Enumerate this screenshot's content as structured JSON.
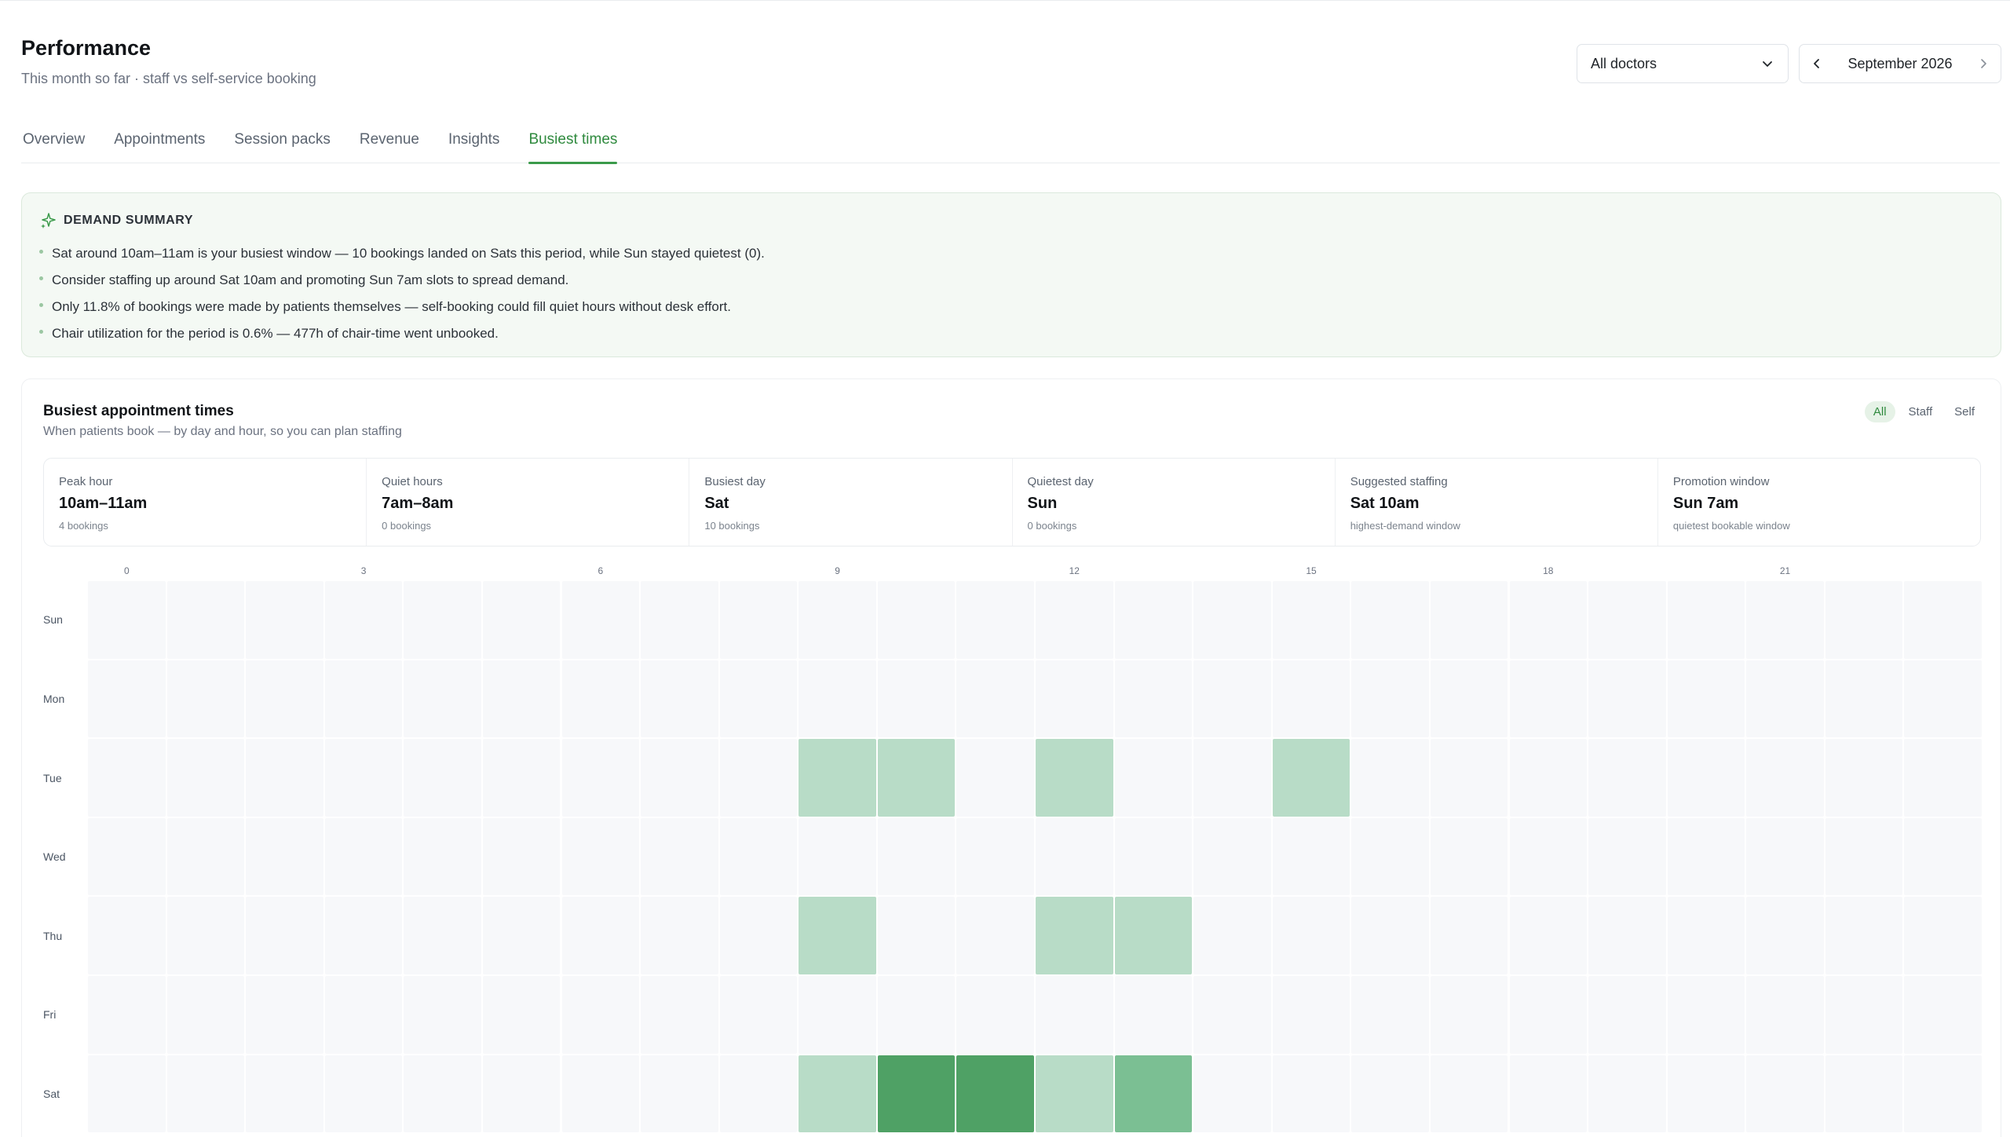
{
  "header": {
    "title": "Performance",
    "subtitle": "This month so far · staff vs self-service booking"
  },
  "controls": {
    "doctor_select": "All doctors",
    "month": "September 2026",
    "icons": [
      "chevron-down-icon",
      "chevron-left-icon",
      "chevron-right-icon"
    ]
  },
  "tabs": [
    {
      "label": "Overview",
      "active": false
    },
    {
      "label": "Appointments",
      "active": false
    },
    {
      "label": "Session packs",
      "active": false
    },
    {
      "label": "Revenue",
      "active": false
    },
    {
      "label": "Insights",
      "active": false
    },
    {
      "label": "Busiest times",
      "active": true
    }
  ],
  "summary": {
    "title": "DEMAND SUMMARY",
    "icon": "sparkle-icon",
    "bullets": [
      "Sat around 10am–11am is your busiest window — 10 bookings landed on Sats this period, while Sun stayed quietest (0).",
      "Consider staffing up around Sat 10am and promoting Sun 7am slots to spread demand.",
      "Only 11.8% of bookings were made by patients themselves — self-booking could fill quiet hours without desk effort.",
      "Chair utilization for the period is 0.6% — 477h of chair-time went unbooked."
    ]
  },
  "panel": {
    "title": "Busiest appointment times",
    "subtitle": "When patients book — by day and hour, so you can plan staffing",
    "filters": [
      {
        "label": "All",
        "active": true
      },
      {
        "label": "Staff",
        "active": false
      },
      {
        "label": "Self",
        "active": false
      }
    ],
    "stats": [
      {
        "label": "Peak hour",
        "value": "10am–11am",
        "note": "4 bookings"
      },
      {
        "label": "Quiet hours",
        "value": "7am–8am",
        "note": "0 bookings"
      },
      {
        "label": "Busiest day",
        "value": "Sat",
        "note": "10 bookings"
      },
      {
        "label": "Quietest day",
        "value": "Sun",
        "note": "0 bookings"
      },
      {
        "label": "Suggested staffing",
        "value": "Sat 10am",
        "note": "highest-demand window"
      },
      {
        "label": "Promotion window",
        "value": "Sun 7am",
        "note": "quietest bookable window"
      }
    ]
  },
  "colors": {
    "accent": "#2f8a3e",
    "empty_cell": "#f7f8fa",
    "level_1": "#b8dcc7",
    "level_2": "#7bbf93",
    "level_3": "#4fa165"
  },
  "chart_data": {
    "type": "heatmap",
    "x_tick_labels": [
      "0",
      "3",
      "6",
      "9",
      "12",
      "15",
      "18",
      "21"
    ],
    "x": [
      0,
      1,
      2,
      3,
      4,
      5,
      6,
      7,
      8,
      9,
      10,
      11,
      12,
      13,
      14,
      15,
      16,
      17,
      18,
      19,
      20,
      21,
      22,
      23
    ],
    "y": [
      "Sun",
      "Mon",
      "Tue",
      "Wed",
      "Thu",
      "Fri",
      "Sat"
    ],
    "values": [
      [
        0,
        0,
        0,
        0,
        0,
        0,
        0,
        0,
        0,
        0,
        0,
        0,
        0,
        0,
        0,
        0,
        0,
        0,
        0,
        0,
        0,
        0,
        0,
        0
      ],
      [
        0,
        0,
        0,
        0,
        0,
        0,
        0,
        0,
        0,
        0,
        0,
        0,
        0,
        0,
        0,
        0,
        0,
        0,
        0,
        0,
        0,
        0,
        0,
        0
      ],
      [
        0,
        0,
        0,
        0,
        0,
        0,
        0,
        0,
        0,
        1,
        1,
        0,
        1,
        0,
        0,
        1,
        0,
        0,
        0,
        0,
        0,
        0,
        0,
        0
      ],
      [
        0,
        0,
        0,
        0,
        0,
        0,
        0,
        0,
        0,
        0,
        0,
        0,
        0,
        0,
        0,
        0,
        0,
        0,
        0,
        0,
        0,
        0,
        0,
        0
      ],
      [
        0,
        0,
        0,
        0,
        0,
        0,
        0,
        0,
        0,
        1,
        0,
        0,
        1,
        1,
        0,
        0,
        0,
        0,
        0,
        0,
        0,
        0,
        0,
        0
      ],
      [
        0,
        0,
        0,
        0,
        0,
        0,
        0,
        0,
        0,
        0,
        0,
        0,
        0,
        0,
        0,
        0,
        0,
        0,
        0,
        0,
        0,
        0,
        0,
        0
      ],
      [
        0,
        0,
        0,
        0,
        0,
        0,
        0,
        0,
        0,
        1,
        3,
        3,
        1,
        2,
        0,
        0,
        0,
        0,
        0,
        0,
        0,
        0,
        0,
        0
      ]
    ]
  }
}
